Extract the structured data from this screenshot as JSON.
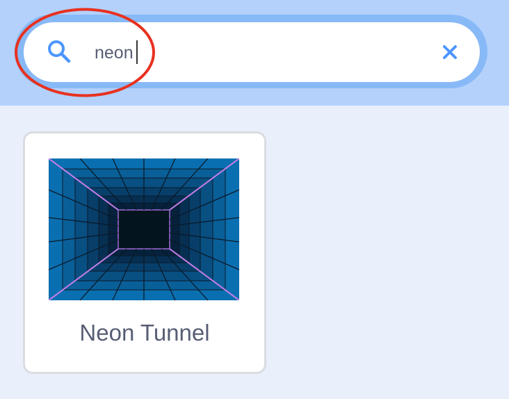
{
  "search": {
    "value": "neon",
    "icon": "search-icon",
    "clear_icon": "close-icon"
  },
  "results": [
    {
      "label": "Neon Tunnel",
      "thumbnail": "neon-tunnel-thumbnail"
    }
  ],
  "colors": {
    "header_bg": "#b3d1fb",
    "search_ring": "#88b9f7",
    "accent_blue": "#4c97ff",
    "annotation_red": "#e8311f",
    "text": "#575e75",
    "page_bg": "#e9f0fc"
  }
}
